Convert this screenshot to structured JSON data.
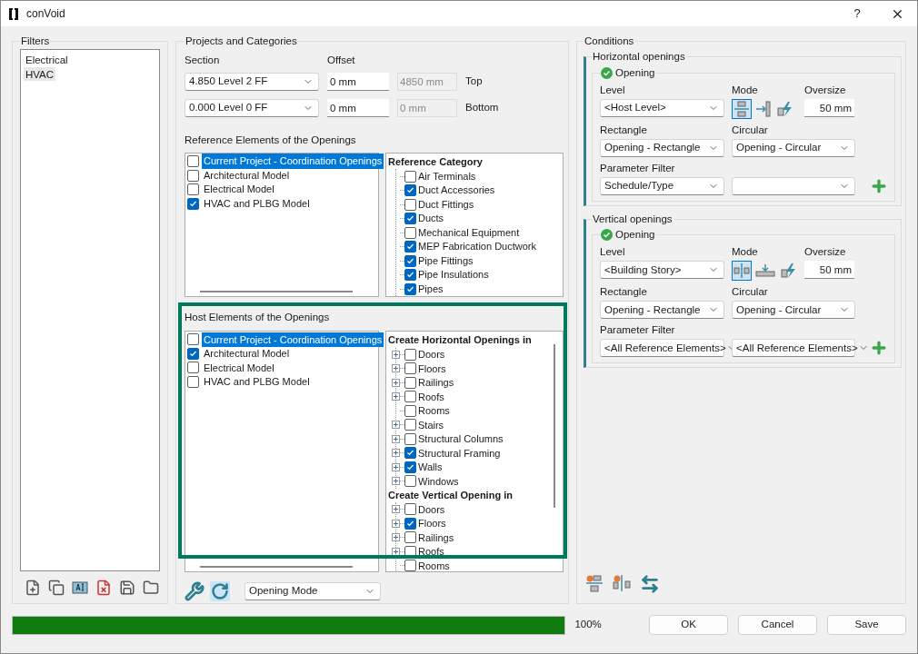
{
  "window": {
    "title": "conVoid",
    "help": "?"
  },
  "filters": {
    "title": "Filters",
    "items": [
      {
        "label": "Electrical",
        "selected": false
      },
      {
        "label": "HVAC",
        "selected": true
      }
    ]
  },
  "projects": {
    "title": "Projects and Categories",
    "section_label": "Section",
    "offset_label": "Offset",
    "rows": [
      {
        "section": "4.850  Level 2 FF",
        "offset": "0 mm",
        "computed": "4850 mm",
        "position": "Top"
      },
      {
        "section": "0.000  Level 0 FF",
        "offset": "0 mm",
        "computed": "0 mm",
        "position": "Bottom"
      }
    ],
    "reference": {
      "title": "Reference Elements of the Openings",
      "models": [
        {
          "label": "Current Project - Coordination Openings",
          "checked": false,
          "selected": true
        },
        {
          "label": "Architectural Model",
          "checked": false,
          "selected": false
        },
        {
          "label": "Electrical Model",
          "checked": false,
          "selected": false
        },
        {
          "label": "HVAC and PLBG Model",
          "checked": true,
          "selected": false
        }
      ],
      "groups": [
        {
          "title": "Reference Category",
          "items": [
            {
              "label": "Air Terminals",
              "checked": false,
              "expandable": false
            },
            {
              "label": "Duct Accessories",
              "checked": true,
              "expandable": false
            },
            {
              "label": "Duct Fittings",
              "checked": false,
              "expandable": false
            },
            {
              "label": "Ducts",
              "checked": true,
              "expandable": false
            },
            {
              "label": "Mechanical Equipment",
              "checked": false,
              "expandable": false
            },
            {
              "label": "MEP Fabrication Ductwork",
              "checked": true,
              "expandable": false
            },
            {
              "label": "Pipe Fittings",
              "checked": true,
              "expandable": false
            },
            {
              "label": "Pipe Insulations",
              "checked": true,
              "expandable": false
            },
            {
              "label": "Pipes",
              "checked": true,
              "expandable": false
            }
          ]
        }
      ]
    },
    "host": {
      "title": "Host Elements of the Openings",
      "models": [
        {
          "label": "Current Project - Coordination Openings",
          "checked": false,
          "selected": true
        },
        {
          "label": "Architectural Model",
          "checked": true,
          "selected": false
        },
        {
          "label": "Electrical Model",
          "checked": false,
          "selected": false
        },
        {
          "label": "HVAC and PLBG Model",
          "checked": false,
          "selected": false
        }
      ],
      "groups": [
        {
          "title": "Create Horizontal Openings in",
          "items": [
            {
              "label": "Doors",
              "checked": false,
              "expandable": true
            },
            {
              "label": "Floors",
              "checked": false,
              "expandable": true
            },
            {
              "label": "Railings",
              "checked": false,
              "expandable": true
            },
            {
              "label": "Roofs",
              "checked": false,
              "expandable": true
            },
            {
              "label": "Rooms",
              "checked": false,
              "expandable": false
            },
            {
              "label": "Stairs",
              "checked": false,
              "expandable": true
            },
            {
              "label": "Structural Columns",
              "checked": false,
              "expandable": true
            },
            {
              "label": "Structural Framing",
              "checked": true,
              "expandable": true
            },
            {
              "label": "Walls",
              "checked": true,
              "expandable": true
            },
            {
              "label": "Windows",
              "checked": false,
              "expandable": true
            }
          ]
        },
        {
          "title": "Create Vertical Opening in",
          "items": [
            {
              "label": "Doors",
              "checked": false,
              "expandable": true
            },
            {
              "label": "Floors",
              "checked": true,
              "expandable": true
            },
            {
              "label": "Railings",
              "checked": false,
              "expandable": true
            },
            {
              "label": "Roofs",
              "checked": false,
              "expandable": true
            },
            {
              "label": "Rooms",
              "checked": false,
              "expandable": false
            }
          ]
        }
      ]
    },
    "mode_select": "Opening Mode"
  },
  "conditions": {
    "title": "Conditions",
    "sections": [
      {
        "title": "Horizontal openings",
        "opening": "Opening",
        "level_label": "Level",
        "level": "<Host Level>",
        "mode_label": "Mode",
        "modes": [
          {
            "kind": "split",
            "selected": true
          },
          {
            "kind": "offset",
            "selected": false
          },
          {
            "kind": "bolt",
            "selected": false
          }
        ],
        "oversize_label": "Oversize",
        "oversize": "50 mm",
        "rectangle_label": "Rectangle",
        "rectangle": "Opening - Rectangle",
        "circular_label": "Circular",
        "circular": "Opening - Circular",
        "filter_label": "Parameter Filter",
        "filter_1": "Schedule/Type"
      },
      {
        "title": "Vertical openings",
        "opening": "Opening",
        "level_label": "Level",
        "level": "<Building Story>",
        "mode_label": "Mode",
        "modes": [
          {
            "kind": "vsplit",
            "selected": true
          },
          {
            "kind": "recess",
            "selected": false
          },
          {
            "kind": "bolt",
            "selected": false
          }
        ],
        "oversize_label": "Oversize",
        "oversize": "50 mm",
        "rectangle_label": "Rectangle",
        "rectangle": "Opening - Rectangle",
        "circular_label": "Circular",
        "circular": "Opening - Circular",
        "filter_label": "Parameter Filter",
        "filter_1": "<All Reference Elements>",
        "filter_2": "<All Reference Elements>"
      }
    ]
  },
  "progress": {
    "level": 1,
    "reading": "100%"
  },
  "buttons": [
    "OK",
    "Cancel",
    "Save"
  ]
}
